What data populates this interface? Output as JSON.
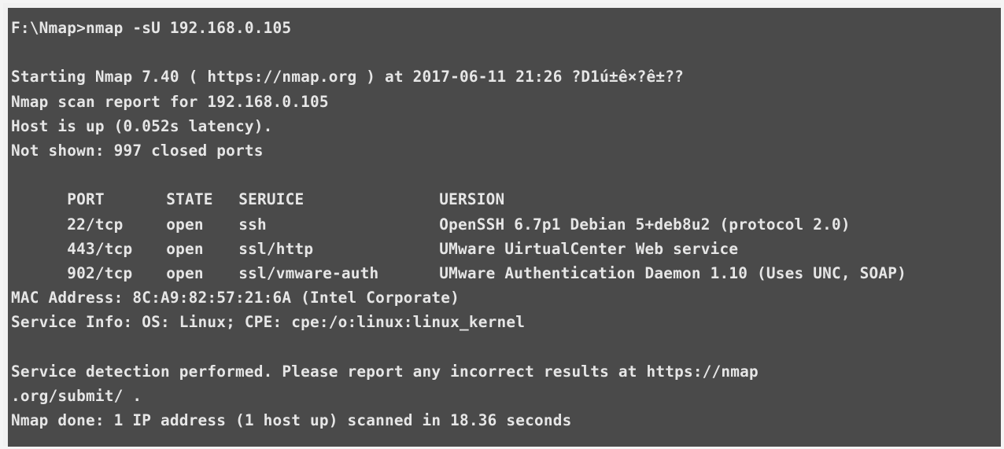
{
  "terminal": {
    "command": "F:\\Nmap>nmap -sU 192.168.0.105",
    "starting": "Starting Nmap 7.40 ( https://nmap.org ) at 2017-06-11 21:26 ?D1ú±ê×?ê±??",
    "report": "Nmap scan report for 192.168.0.105",
    "host_up": "Host is up (0.052s latency).",
    "not_shown": "Not shown: 997 closed ports",
    "table": {
      "headers": [
        "PORT",
        "STATE",
        "SERUICE",
        "UERSION"
      ],
      "rows": [
        [
          "22/tcp",
          "open",
          "ssh",
          "OpenSSH 6.7p1 Debian 5+deb8u2 (protocol 2.0)"
        ],
        [
          "443/tcp",
          "open",
          "ssl/http",
          "UMware UirtualCenter Web service"
        ],
        [
          "902/tcp",
          "open",
          "ssl/vmware-auth",
          "UMware Authentication Daemon 1.10 (Uses UNC, SOAP)"
        ]
      ]
    },
    "mac": "MAC Address: 8C:A9:82:57:21:6A (Intel Corporate)",
    "service_info": "Service Info: OS: Linux; CPE: cpe:/o:linux:linux_kernel",
    "detection_1": "Service detection performed. Please report any incorrect results at https://nmap",
    "detection_2": ".org/submit/ .",
    "done": "Nmap done: 1 IP address (1 host up) scanned in 18.36 seconds"
  }
}
